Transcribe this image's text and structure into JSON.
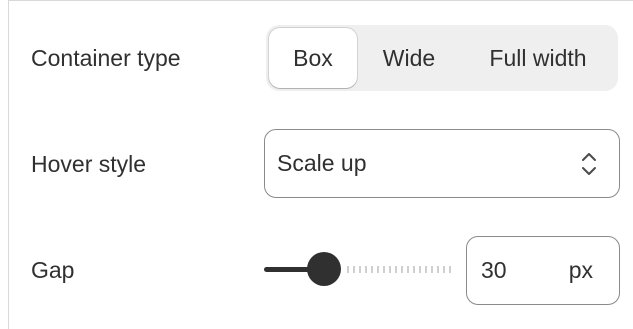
{
  "container_type": {
    "label": "Container type",
    "options": [
      "Box",
      "Wide",
      "Full width"
    ],
    "selected": "Box"
  },
  "hover_style": {
    "label": "Hover style",
    "value": "Scale up",
    "icon": "chevron-up-down-icon"
  },
  "gap": {
    "label": "Gap",
    "value": "30",
    "unit": "px",
    "slider_fraction": 0.32
  },
  "colors": {
    "text": "#303030",
    "border": "#8a8a8a",
    "segment_bg": "#efefef",
    "slider_active": "#303030",
    "slider_inactive": "#cfcfcf"
  }
}
